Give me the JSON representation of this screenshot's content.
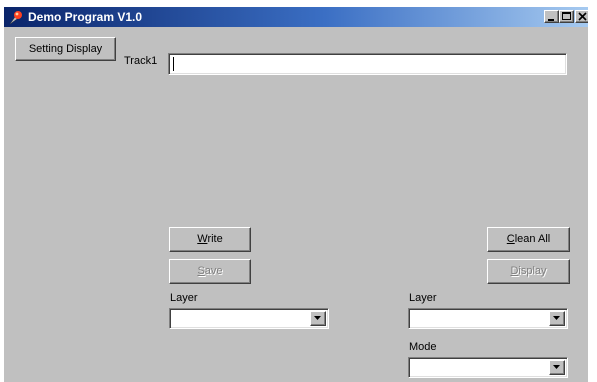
{
  "window": {
    "title": "Demo Program V1.0",
    "app_icon": "pin-icon",
    "controls": [
      "minimize-icon",
      "maximize-icon",
      "close-icon"
    ]
  },
  "buttons": {
    "setting_display": "Setting Display",
    "write": {
      "accel": "W",
      "rest": "rite"
    },
    "save": {
      "accel": "S",
      "rest": "ave"
    },
    "clean_all": {
      "accel": "C",
      "rest": "lean All"
    },
    "display": {
      "accel": "D",
      "rest": "isplay"
    }
  },
  "states": {
    "save_enabled": false,
    "display_enabled": false
  },
  "track1": {
    "label": "Track1",
    "value": ""
  },
  "left_panel": {
    "layer_label": "Layer",
    "layer_value": ""
  },
  "right_panel": {
    "layer_label": "Layer",
    "layer_value": "",
    "mode_label": "Mode",
    "mode_value": ""
  },
  "colors": {
    "face": "#c0c0c0",
    "titlebar_start": "#0a246a",
    "titlebar_end": "#a6caf0",
    "disabled_text": "#808080"
  }
}
